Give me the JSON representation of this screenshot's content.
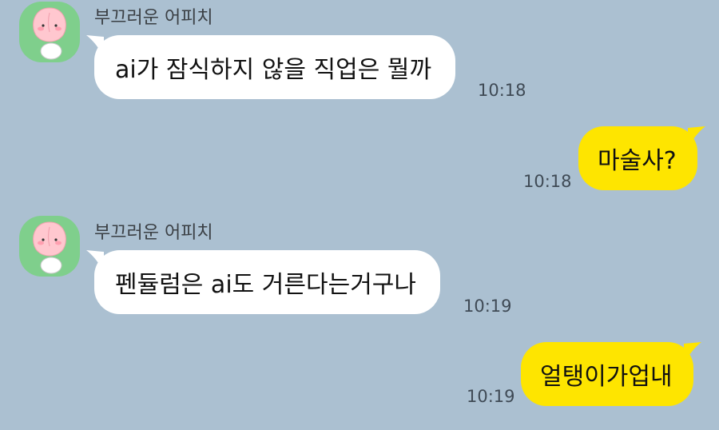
{
  "messages": [
    {
      "direction": "incoming",
      "sender": "부끄러운 어피치",
      "avatar_icon": "apeach-peach-icon",
      "text": "ai가 잠식하지 않을 직업은 뭘까",
      "time": "10:18"
    },
    {
      "direction": "outgoing",
      "text": "마술사?",
      "time": "10:18"
    },
    {
      "direction": "incoming",
      "sender": "부끄러운 어피치",
      "avatar_icon": "apeach-peach-icon",
      "text": "펜듈럼은 ai도 거른다는거구나",
      "time": "10:19"
    },
    {
      "direction": "outgoing",
      "text": "얼탱이가업내",
      "time": "10:19"
    }
  ],
  "colors": {
    "background": "#abc0d1",
    "incoming_bubble": "#ffffff",
    "outgoing_bubble": "#fee500",
    "avatar_background": "#7fcf8c"
  }
}
